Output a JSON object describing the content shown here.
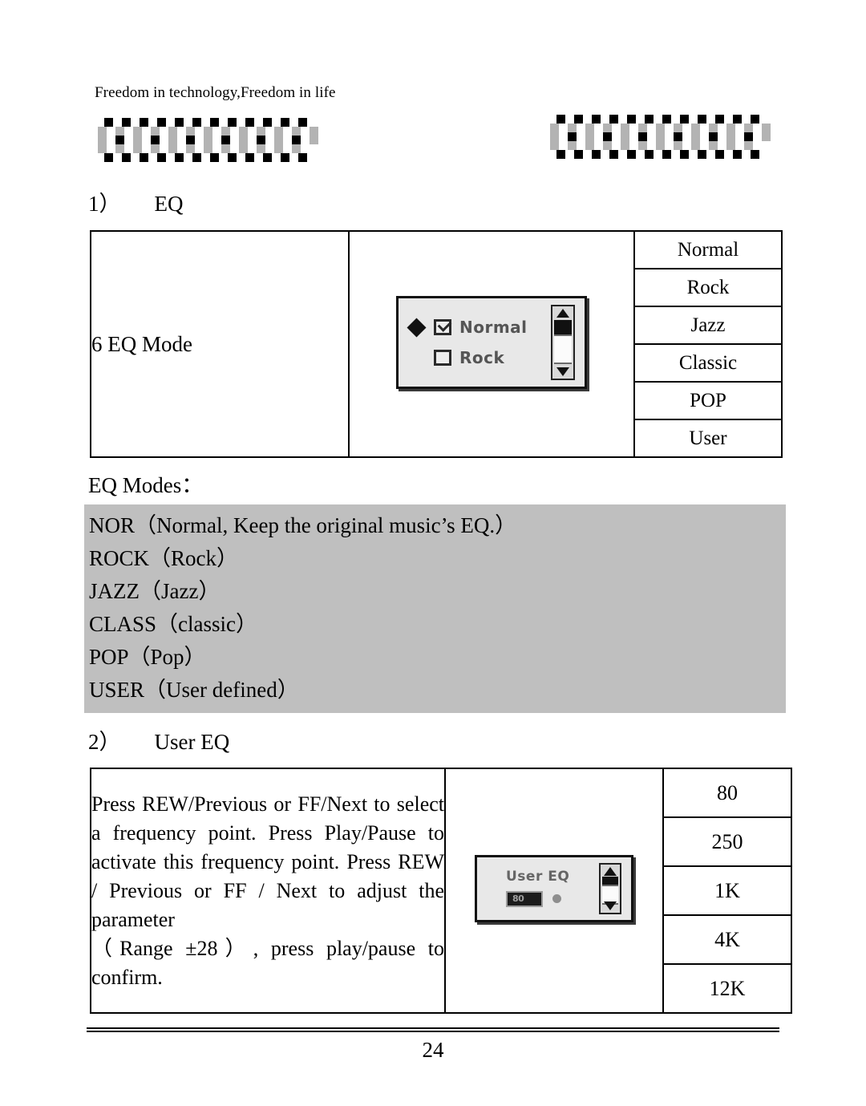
{
  "header": {
    "tagline": "Freedom in technology,Freedom in life",
    "decoration_left": "checkerboard-band",
    "decoration_right": "checkerboard-band"
  },
  "colors": {
    "grey_block": "#bfbfbf",
    "screen_face": "#e8e8e8",
    "ink": "#000000",
    "deco_grey": "#b3b3b3",
    "deco_black": "#000000"
  },
  "sections": [
    {
      "number": "1）",
      "title": "EQ"
    },
    {
      "number": "2）",
      "title": "User EQ"
    }
  ],
  "eq_table": {
    "label": "6 EQ Mode",
    "screen": {
      "items": [
        {
          "text": "Normal",
          "checked": true,
          "selected": true
        },
        {
          "text": "Rock",
          "checked": false,
          "selected": false
        }
      ],
      "scrollbar": "vertical-scrollbar"
    },
    "modes": [
      "Normal",
      "Rock",
      "Jazz",
      "Classic",
      "POP",
      "User"
    ]
  },
  "eq_modes": {
    "title": "EQ Modes：",
    "lines": [
      "NOR（Normal, Keep the original music’s EQ.）",
      "ROCK（Rock）",
      "JAZZ（Jazz）",
      "CLASS（classic）",
      "POP（Pop）",
      "USER（User defined）"
    ]
  },
  "user_eq_table": {
    "instructions": [
      "Press REW/Previous or FF/Next to select a frequency point. Press Play/Pause to activate this frequency point. Press REW / Previous or FF / Next to adjust the parameter",
      "（Range ±28）, press play/pause to confirm."
    ],
    "screen": {
      "title": "User EQ",
      "value": "80",
      "scrollbar": "vertical-scrollbar"
    },
    "frequencies": [
      "80",
      "250",
      "1K",
      "4K",
      "12K"
    ]
  },
  "footer": {
    "page_number": "24"
  }
}
